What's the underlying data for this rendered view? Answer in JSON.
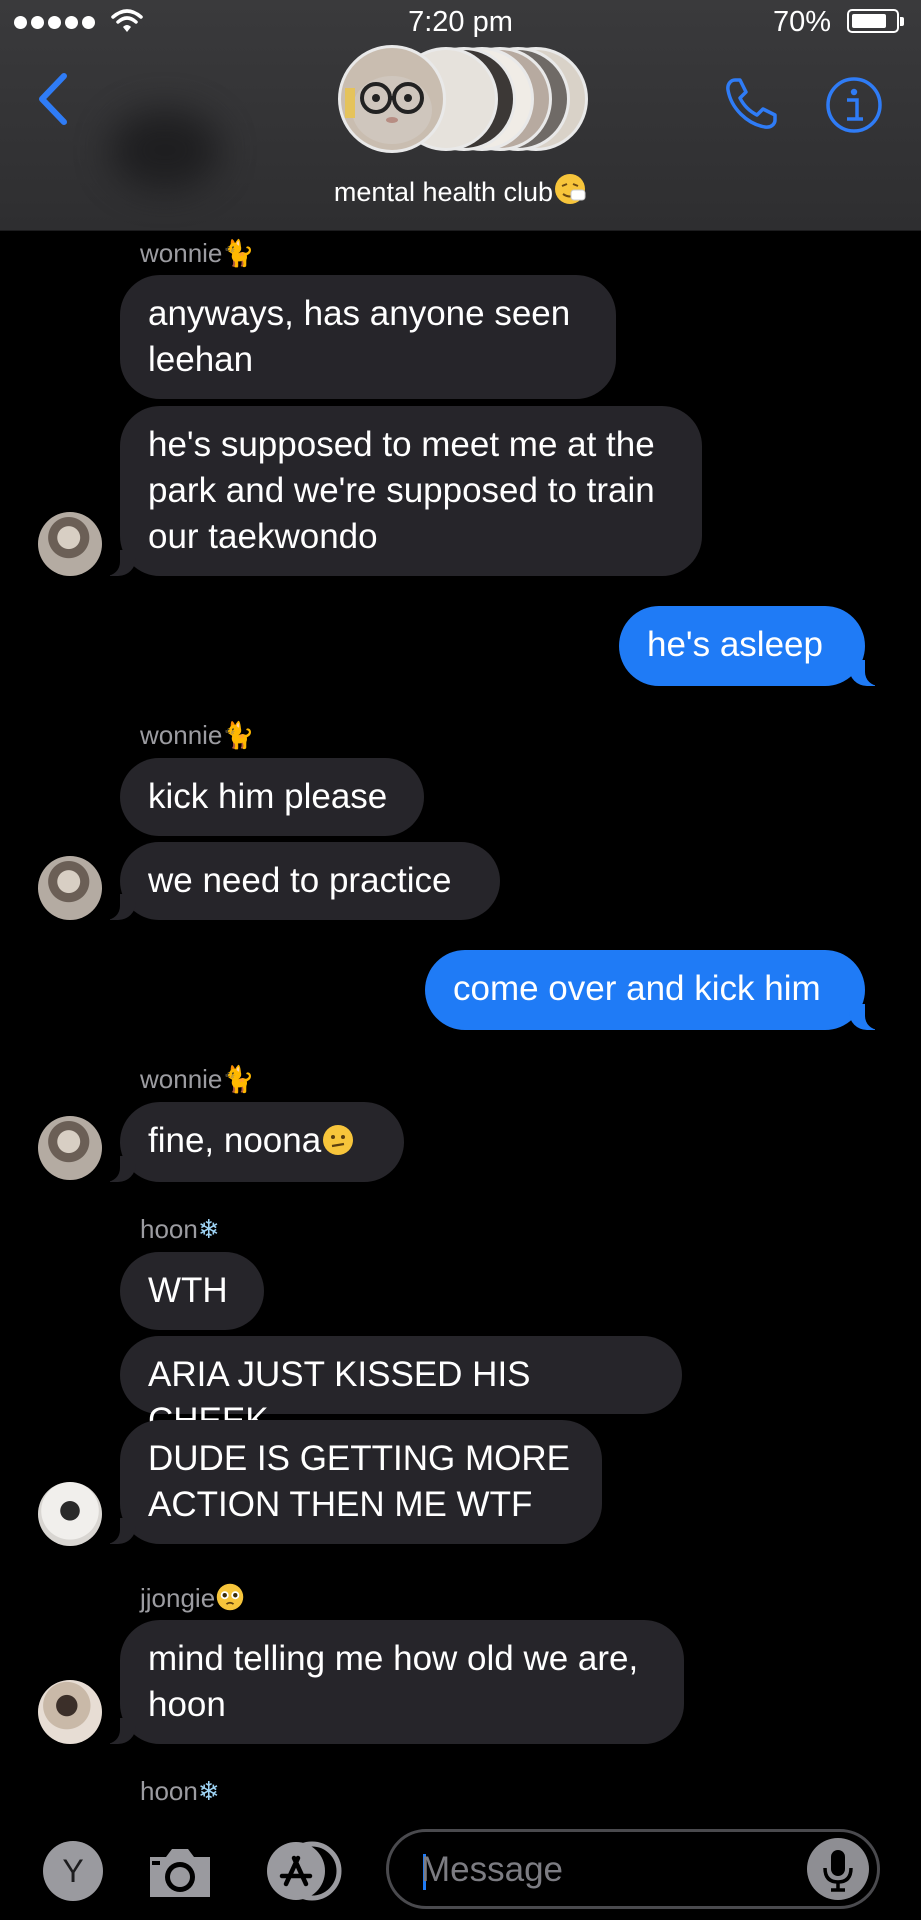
{
  "status": {
    "time": "7:20 pm",
    "battery": "70%",
    "battery_level": 0.7
  },
  "nav": {
    "group_name": "mental health club"
  },
  "messages": {
    "m1": {
      "sender": "wonnie",
      "text_line1": "anyways, has anyone seen",
      "text_line2": "leehan"
    },
    "m2": {
      "text_line1": "he's supposed to meet me at the",
      "text_line2": "park and we're supposed to train",
      "text_line3": "our taekwondo"
    },
    "m3": {
      "text": "he's asleep"
    },
    "m4": {
      "sender": "wonnie",
      "text": "kick him please"
    },
    "m5": {
      "text": "we need to practice"
    },
    "m6": {
      "text": "come over and kick him"
    },
    "m7": {
      "sender": "wonnie",
      "text": "fine, noona"
    },
    "m8": {
      "sender": "hoon",
      "text": "WTH"
    },
    "m9": {
      "text": "ARIA JUST KISSED HIS CHEEK"
    },
    "m10": {
      "text_line1": "DUDE IS GETTING MORE",
      "text_line2": "ACTION THEN ME WTF"
    },
    "m11": {
      "sender": "jjongie",
      "text_line1": "mind telling me how old we are,",
      "text_line2": "hoon"
    },
    "m12": {
      "sender": "hoon"
    }
  },
  "compose": {
    "app_button": "Y",
    "placeholder": "Message"
  },
  "colors": {
    "outgoing": "#1f7bf6",
    "incoming": "#26252a",
    "accent": "#2f7cf6"
  }
}
